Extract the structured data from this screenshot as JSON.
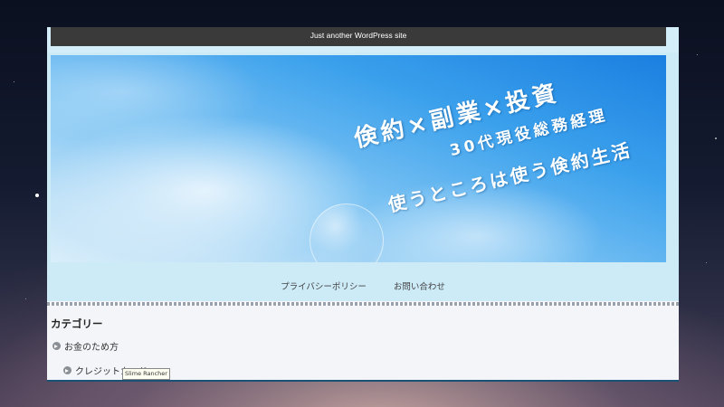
{
  "site": {
    "tagline": "Just another WordPress site"
  },
  "banner": {
    "line1": "倹約×副業×投資",
    "line2": "30代現役総務経理",
    "line3": "使うところは使う倹約生活"
  },
  "nav": {
    "items": [
      "プライバシーポリシー",
      "お問い合わせ"
    ]
  },
  "sidebar": {
    "title": "カテゴリー",
    "categories": [
      "お金のため方",
      "クレジットカード"
    ]
  },
  "tooltip": {
    "text": "Slime Rancher"
  },
  "colors": {
    "topbar": "#3a3a3a",
    "header_bg": "#cdeaf7",
    "accent": "#1a5276"
  }
}
